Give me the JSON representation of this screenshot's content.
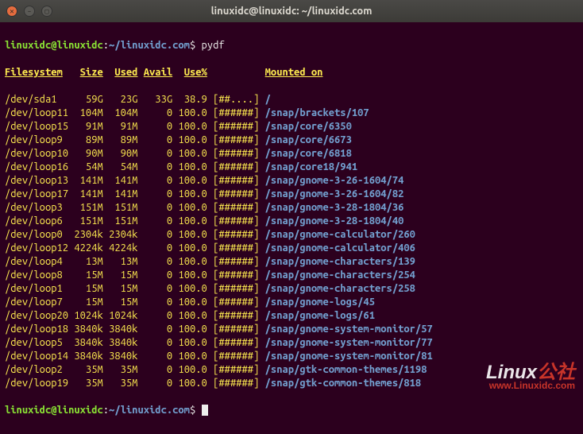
{
  "window": {
    "title": "linuxidc@linuxidc: ~/linuxidc.com"
  },
  "prompt": {
    "userhost": "linuxidc@linuxidc",
    "sep": ":",
    "path": "~/linuxidc.com",
    "dollar": "$ ",
    "command": "pydf"
  },
  "header": {
    "fs": "Filesystem",
    "size": "Size",
    "used": "Used",
    "avail": "Avail",
    "usep": "Use%",
    "bar_spacer": "        ",
    "mount": "Mounted on"
  },
  "rows": [
    {
      "fs": "/dev/sda1  ",
      "size": "  59G",
      "used": "  23G",
      "avail": "  33G",
      "usep": " 38.9",
      "bar": "[##....]",
      "mount": "/"
    },
    {
      "fs": "/dev/loop11",
      "size": " 104M",
      "used": " 104M",
      "avail": "    0",
      "usep": "100.0",
      "bar": "[######]",
      "mount": "/snap/brackets/107"
    },
    {
      "fs": "/dev/loop15",
      "size": "  91M",
      "used": "  91M",
      "avail": "    0",
      "usep": "100.0",
      "bar": "[######]",
      "mount": "/snap/core/6350"
    },
    {
      "fs": "/dev/loop9 ",
      "size": "  89M",
      "used": "  89M",
      "avail": "    0",
      "usep": "100.0",
      "bar": "[######]",
      "mount": "/snap/core/6673"
    },
    {
      "fs": "/dev/loop10",
      "size": "  90M",
      "used": "  90M",
      "avail": "    0",
      "usep": "100.0",
      "bar": "[######]",
      "mount": "/snap/core/6818"
    },
    {
      "fs": "/dev/loop16",
      "size": "  54M",
      "used": "  54M",
      "avail": "    0",
      "usep": "100.0",
      "bar": "[######]",
      "mount": "/snap/core18/941"
    },
    {
      "fs": "/dev/loop13",
      "size": " 141M",
      "used": " 141M",
      "avail": "    0",
      "usep": "100.0",
      "bar": "[######]",
      "mount": "/snap/gnome-3-26-1604/74"
    },
    {
      "fs": "/dev/loop17",
      "size": " 141M",
      "used": " 141M",
      "avail": "    0",
      "usep": "100.0",
      "bar": "[######]",
      "mount": "/snap/gnome-3-26-1604/82"
    },
    {
      "fs": "/dev/loop3 ",
      "size": " 151M",
      "used": " 151M",
      "avail": "    0",
      "usep": "100.0",
      "bar": "[######]",
      "mount": "/snap/gnome-3-28-1804/36"
    },
    {
      "fs": "/dev/loop6 ",
      "size": " 151M",
      "used": " 151M",
      "avail": "    0",
      "usep": "100.0",
      "bar": "[######]",
      "mount": "/snap/gnome-3-28-1804/40"
    },
    {
      "fs": "/dev/loop0 ",
      "size": "2304k",
      "used": "2304k",
      "avail": "    0",
      "usep": "100.0",
      "bar": "[######]",
      "mount": "/snap/gnome-calculator/260"
    },
    {
      "fs": "/dev/loop12",
      "size": "4224k",
      "used": "4224k",
      "avail": "    0",
      "usep": "100.0",
      "bar": "[######]",
      "mount": "/snap/gnome-calculator/406"
    },
    {
      "fs": "/dev/loop4 ",
      "size": "  13M",
      "used": "  13M",
      "avail": "    0",
      "usep": "100.0",
      "bar": "[######]",
      "mount": "/snap/gnome-characters/139"
    },
    {
      "fs": "/dev/loop8 ",
      "size": "  15M",
      "used": "  15M",
      "avail": "    0",
      "usep": "100.0",
      "bar": "[######]",
      "mount": "/snap/gnome-characters/254"
    },
    {
      "fs": "/dev/loop1 ",
      "size": "  15M",
      "used": "  15M",
      "avail": "    0",
      "usep": "100.0",
      "bar": "[######]",
      "mount": "/snap/gnome-characters/258"
    },
    {
      "fs": "/dev/loop7 ",
      "size": "  15M",
      "used": "  15M",
      "avail": "    0",
      "usep": "100.0",
      "bar": "[######]",
      "mount": "/snap/gnome-logs/45"
    },
    {
      "fs": "/dev/loop20",
      "size": "1024k",
      "used": "1024k",
      "avail": "    0",
      "usep": "100.0",
      "bar": "[######]",
      "mount": "/snap/gnome-logs/61"
    },
    {
      "fs": "/dev/loop18",
      "size": "3840k",
      "used": "3840k",
      "avail": "    0",
      "usep": "100.0",
      "bar": "[######]",
      "mount": "/snap/gnome-system-monitor/57"
    },
    {
      "fs": "/dev/loop5 ",
      "size": "3840k",
      "used": "3840k",
      "avail": "    0",
      "usep": "100.0",
      "bar": "[######]",
      "mount": "/snap/gnome-system-monitor/77"
    },
    {
      "fs": "/dev/loop14",
      "size": "3840k",
      "used": "3840k",
      "avail": "    0",
      "usep": "100.0",
      "bar": "[######]",
      "mount": "/snap/gnome-system-monitor/81"
    },
    {
      "fs": "/dev/loop2 ",
      "size": "  35M",
      "used": "  35M",
      "avail": "    0",
      "usep": "100.0",
      "bar": "[######]",
      "mount": "/snap/gtk-common-themes/1198"
    },
    {
      "fs": "/dev/loop19",
      "size": "  35M",
      "used": "  35M",
      "avail": "    0",
      "usep": "100.0",
      "bar": "[######]",
      "mount": "/snap/gtk-common-themes/818"
    }
  ],
  "watermark": {
    "brand_white": "Linux",
    "brand_red": "公社",
    "url": "www.Linuxidc.com"
  }
}
